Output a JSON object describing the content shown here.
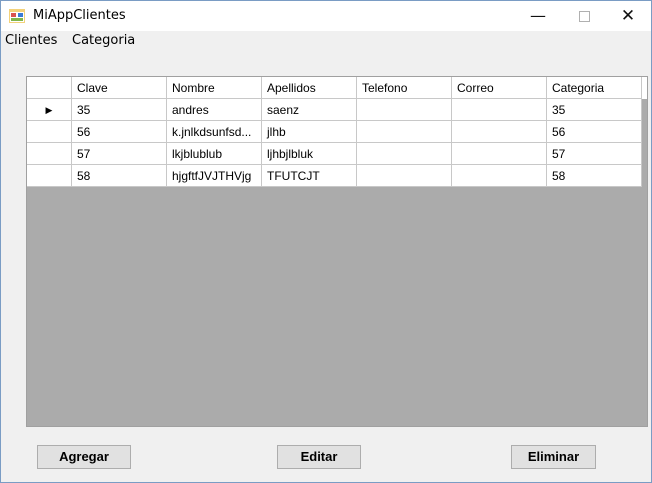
{
  "window": {
    "title": "MiAppClientes",
    "controls": {
      "minimize": "—",
      "close": "✕"
    }
  },
  "menu": {
    "items": [
      "Clientes",
      "Categoria"
    ]
  },
  "grid": {
    "columns": [
      "Clave",
      "Nombre",
      "Apellidos",
      "Telefono",
      "Correo",
      "Categoria"
    ],
    "current_row_marker": "▶",
    "rows": [
      [
        "35",
        "andres",
        "saenz",
        "",
        "",
        "35"
      ],
      [
        "56",
        "k.jnlkdsunfsd...",
        "jlhb",
        "",
        "",
        "56"
      ],
      [
        "57",
        "lkjblublub",
        "ljhbjlbluk",
        "",
        "",
        "57"
      ],
      [
        "58",
        "hjgftfJVJTHVjg",
        "TFUTCJT",
        "",
        "",
        "58"
      ]
    ]
  },
  "buttons": {
    "add": "Agregar",
    "edit": "Editar",
    "delete": "Eliminar"
  }
}
